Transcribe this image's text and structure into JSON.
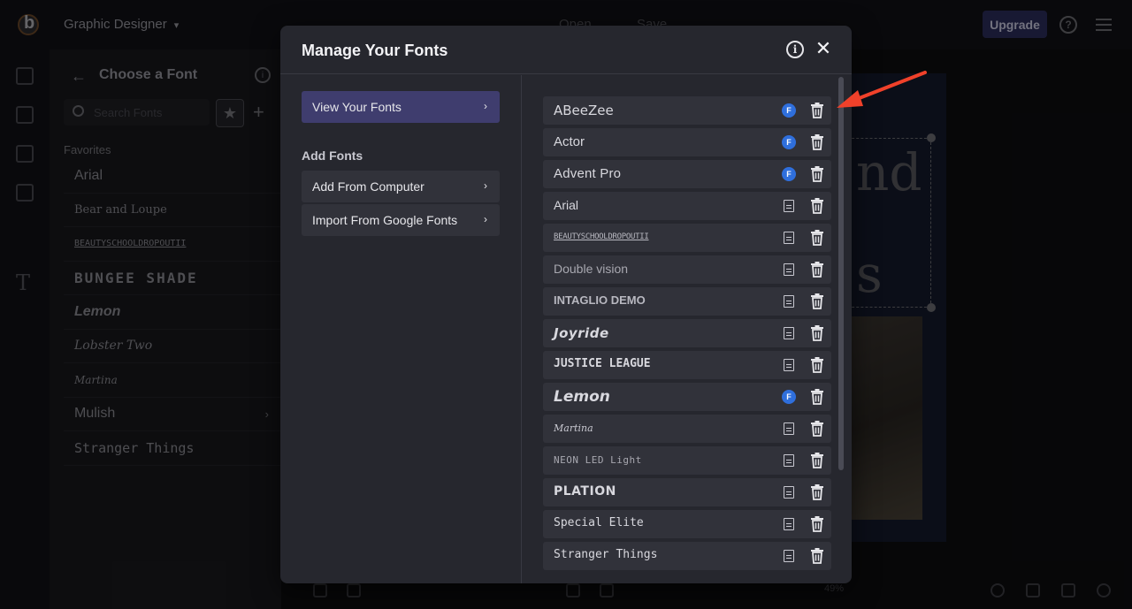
{
  "app": {
    "project_name": "Graphic Designer",
    "menu_open": "Open",
    "menu_save": "Save",
    "upgrade_label": "Upgrade",
    "zoom_level": "49%"
  },
  "font_panel": {
    "title": "Choose a Font",
    "search_placeholder": "Search Fonts",
    "favorites_label": "Favorites",
    "items": [
      {
        "label": "Arial"
      },
      {
        "label": "Bear and Loupe"
      },
      {
        "label": "BEAUTYSCHOOLDROPOUTII"
      },
      {
        "label": "BUNGEE SHADE"
      },
      {
        "label": "Lemon"
      },
      {
        "label": "Lobster Two"
      },
      {
        "label": "Martina"
      },
      {
        "label": "Mulish"
      },
      {
        "label": "Stranger Things"
      }
    ]
  },
  "canvas": {
    "text_line_1": "nd",
    "text_line_2": "s"
  },
  "modal": {
    "title": "Manage Your Fonts",
    "nav": {
      "view_fonts": "View Your Fonts",
      "add_fonts_heading": "Add Fonts",
      "add_from_computer": "Add From Computer",
      "import_google": "Import From Google Fonts"
    },
    "fonts": [
      {
        "name": "ABeeZee",
        "source": "google"
      },
      {
        "name": "Actor",
        "source": "google"
      },
      {
        "name": "Advent Pro",
        "source": "google"
      },
      {
        "name": "Arial",
        "source": "file"
      },
      {
        "name": "BEAUTYSCHOOLDROPOUTII",
        "source": "file"
      },
      {
        "name": "Double vision",
        "source": "file"
      },
      {
        "name": "INTAGLIO DEMO",
        "source": "file"
      },
      {
        "name": "Joyride",
        "source": "file"
      },
      {
        "name": "JUSTICE LEAGUE",
        "source": "file"
      },
      {
        "name": "Lemon",
        "source": "google"
      },
      {
        "name": "Martina",
        "source": "file"
      },
      {
        "name": "NEON LED Light",
        "source": "file"
      },
      {
        "name": "PLATION",
        "source": "file"
      },
      {
        "name": "Special Elite",
        "source": "file"
      },
      {
        "name": "Stranger Things",
        "source": "file"
      }
    ],
    "google_badge": "F"
  },
  "colors": {
    "accent_nav_active": "#3f3d6e",
    "google_badge": "#2f6fdc",
    "annotation_arrow": "#f0412a"
  }
}
